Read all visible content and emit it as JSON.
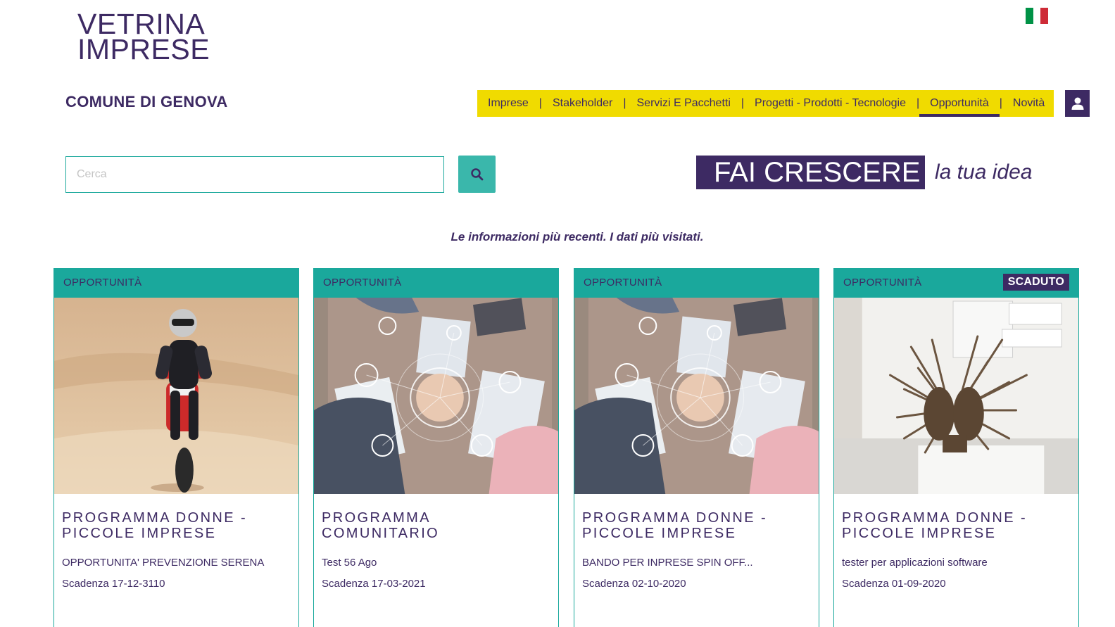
{
  "brand": {
    "line1": "VETRINA",
    "line2": "IMPRESE",
    "subtitle": "COMUNE DI GENOVA"
  },
  "language": {
    "flag_colors": [
      "#009246",
      "#ffffff",
      "#ce2b37"
    ]
  },
  "nav": {
    "items": [
      {
        "label": "Imprese"
      },
      {
        "label": "Stakeholder"
      },
      {
        "label": "Servizi E Pacchetti"
      },
      {
        "label": "Progetti - Prodotti - Tecnologie"
      },
      {
        "label": "Opportunità",
        "active": true
      },
      {
        "label": "Novità"
      }
    ],
    "separator": "|",
    "user_icon": "user-icon"
  },
  "search": {
    "placeholder": "Cerca",
    "value": "",
    "icon": "search-icon"
  },
  "slogan": {
    "highlight": "FAI CRESCERE",
    "rest": "la tua idea"
  },
  "tagline": "Le informazioni più recenti. I dati più visitati.",
  "colors": {
    "primary": "#3d2a63",
    "teal": "#1aa89c",
    "yellow": "#f0db00",
    "button": "#3ab7ab"
  },
  "cards": [
    {
      "category": "OPPORTUNITÀ",
      "badge": "",
      "image": "motocross-desert",
      "title": "PROGRAMMA DONNE - PICCOLE IMPRESE",
      "description": "OPPORTUNITA' PREVENZIONE SERENA",
      "deadline": "Scadenza 17-12-3110"
    },
    {
      "category": "OPPORTUNITÀ",
      "badge": "",
      "image": "team-hands-meeting",
      "title": "PROGRAMMA COMUNITARIO",
      "description": "Test 56 Ago",
      "deadline": "Scadenza 17-03-2021"
    },
    {
      "category": "OPPORTUNITÀ",
      "badge": "",
      "image": "team-hands-meeting",
      "title": "PROGRAMMA DONNE - PICCOLE IMPRESE",
      "description": "BANDO PER INPRESE SPIN OFF...",
      "deadline": "Scadenza 02-10-2020"
    },
    {
      "category": "OPPORTUNITÀ",
      "badge": "SCADUTO",
      "image": "wooden-sculpture",
      "title": "PROGRAMMA DONNE - PICCOLE IMPRESE",
      "description": "tester per applicazioni software",
      "deadline": "Scadenza 01-09-2020"
    }
  ]
}
